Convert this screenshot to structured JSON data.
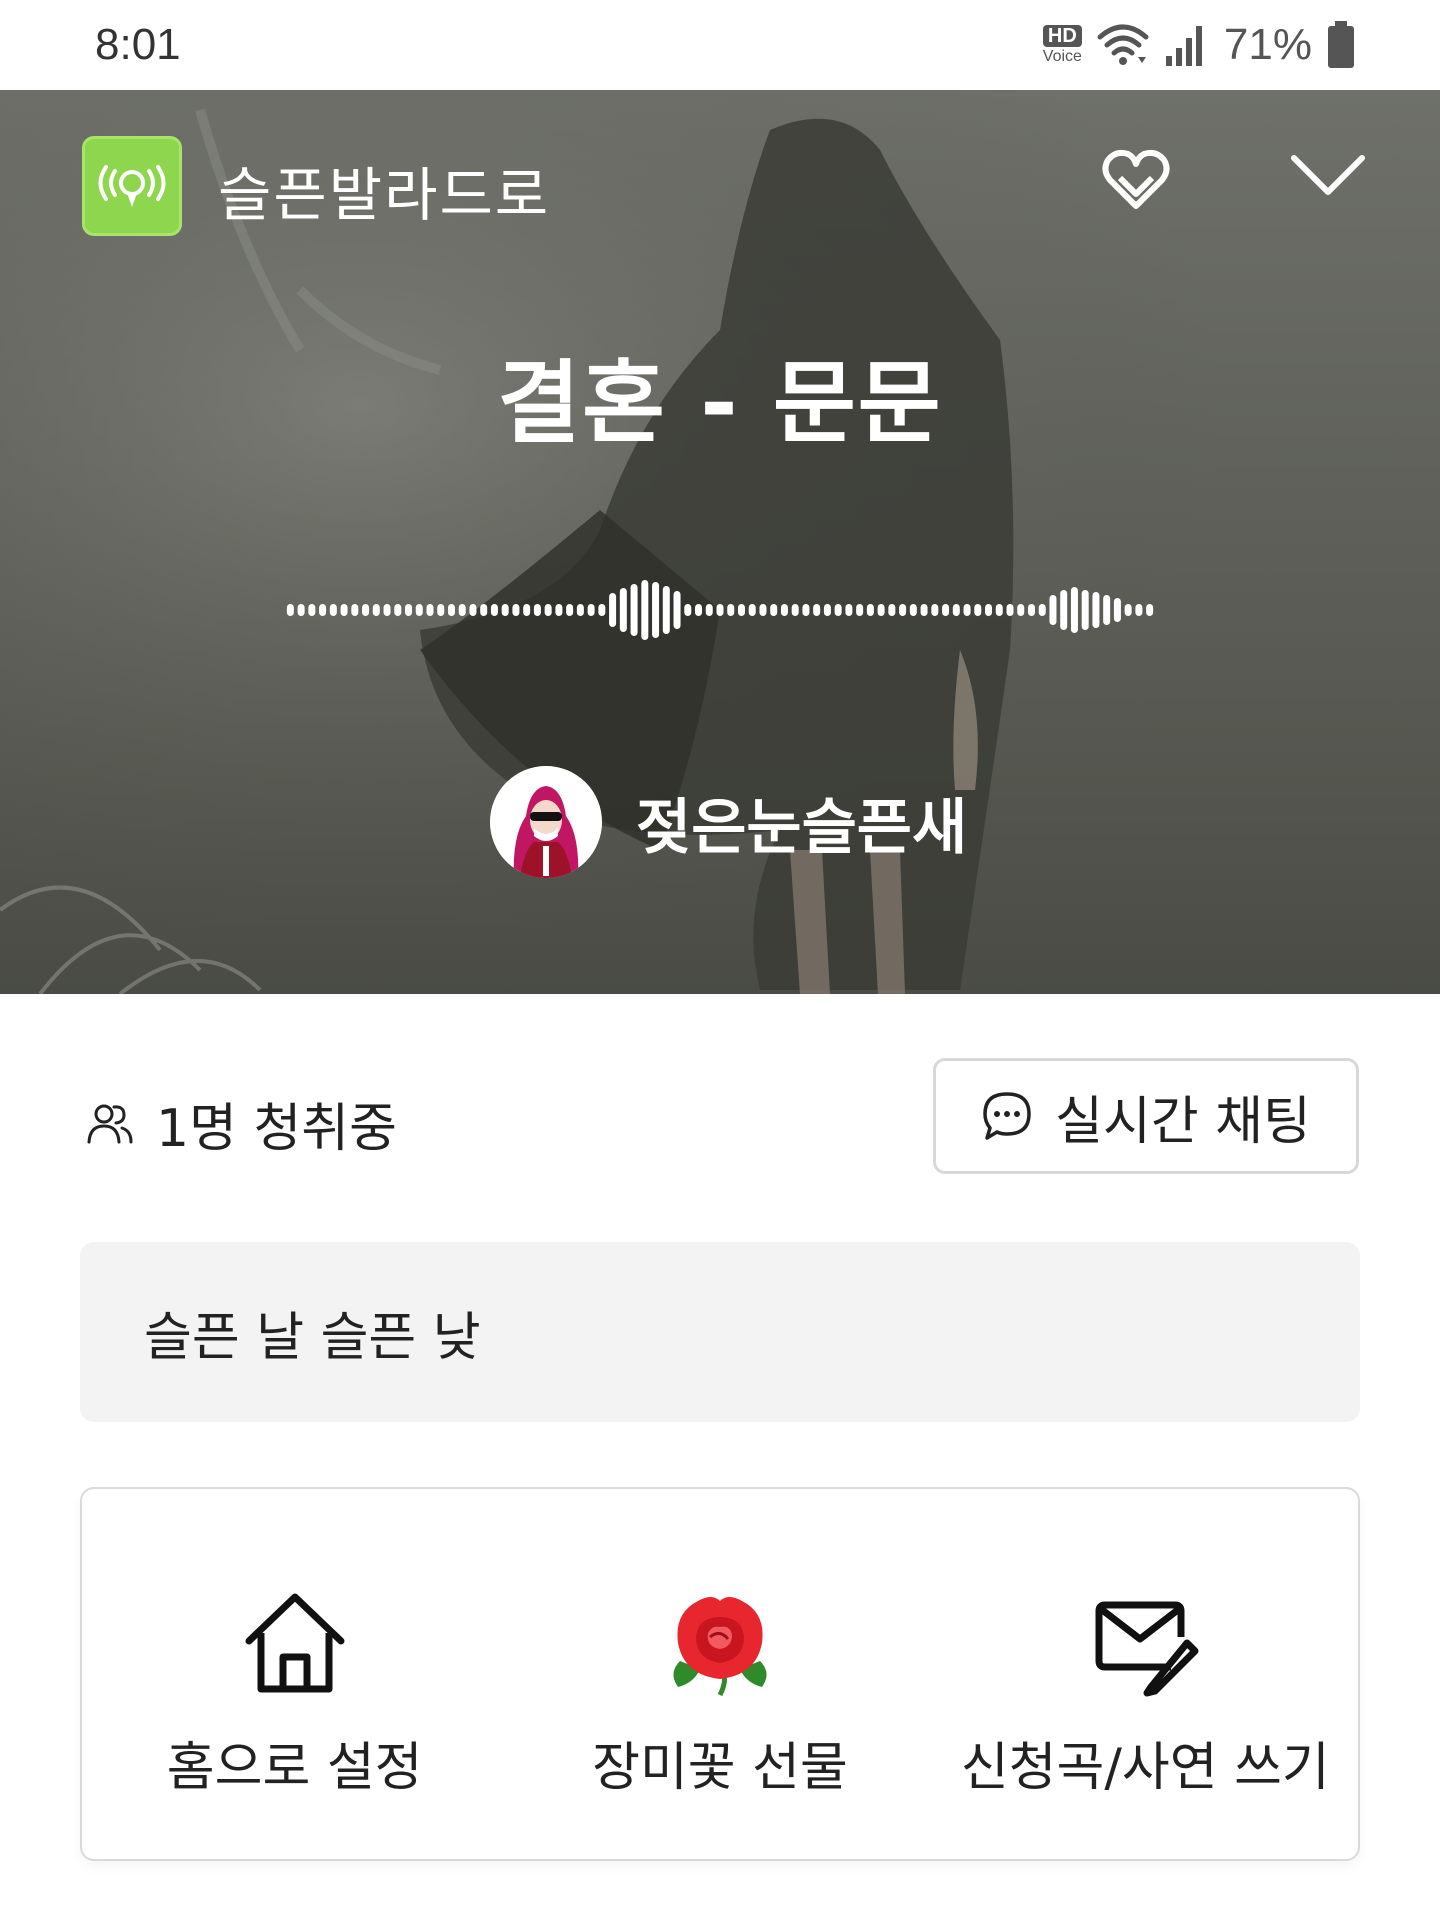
{
  "status_bar": {
    "time": "8:01",
    "hd": "HD",
    "voice": "Voice",
    "battery": "71%",
    "icons": [
      "hd-voice-icon",
      "wifi-icon",
      "signal-icon",
      "battery-icon"
    ]
  },
  "header": {
    "station_name": "슬픈발라드로",
    "station_icon": "broadcast-icon",
    "favorite_icon": "heart-icon",
    "collapse_icon": "chevron-down-icon"
  },
  "now_playing": {
    "title": "결혼 - 문문",
    "dj_name": "젖은눈슬픈새"
  },
  "listeners": {
    "text": "1명 청취중",
    "icon": "people-icon"
  },
  "chat_button": {
    "label": "실시간 채팅",
    "icon": "chat-bubble-icon"
  },
  "notice": {
    "text": "슬픈 날 슬픈 낮"
  },
  "actions": [
    {
      "label": "홈으로 설정",
      "icon": "home-icon"
    },
    {
      "label": "장미꽃 선물",
      "icon": "rose-icon"
    },
    {
      "label": "신청곡/사연 쓰기",
      "icon": "mail-edit-icon"
    }
  ],
  "colors": {
    "station_icon_bg": "#8fd64f",
    "hero_bg": "#61625c",
    "rose": "#e8262e"
  }
}
